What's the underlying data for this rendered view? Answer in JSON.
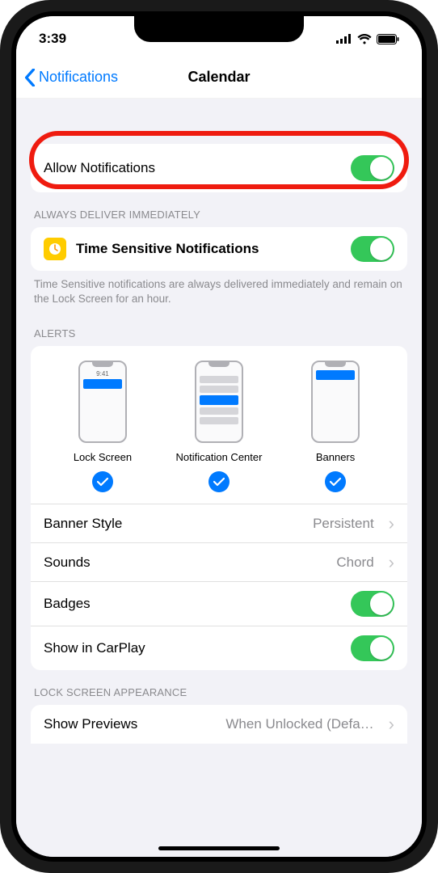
{
  "status": {
    "time": "3:39"
  },
  "nav": {
    "back": "Notifications",
    "title": "Calendar"
  },
  "allow": {
    "label": "Allow Notifications",
    "on": true
  },
  "timeSensitive": {
    "header": "ALWAYS DELIVER IMMEDIATELY",
    "label": "Time Sensitive Notifications",
    "on": true,
    "footer": "Time Sensitive notifications are always delivered immediately and remain on the Lock Screen for an hour."
  },
  "alerts": {
    "header": "ALERTS",
    "options": [
      {
        "label": "Lock Screen",
        "checked": true,
        "miniTime": "9:41"
      },
      {
        "label": "Notification Center",
        "checked": true
      },
      {
        "label": "Banners",
        "checked": true
      }
    ],
    "rows": {
      "bannerStyle": {
        "label": "Banner Style",
        "value": "Persistent"
      },
      "sounds": {
        "label": "Sounds",
        "value": "Chord"
      },
      "badges": {
        "label": "Badges",
        "on": true
      },
      "carplay": {
        "label": "Show in CarPlay",
        "on": true
      }
    }
  },
  "lockScreen": {
    "header": "LOCK SCREEN APPEARANCE",
    "previews": {
      "label": "Show Previews",
      "value": "When Unlocked (Defa…"
    }
  }
}
